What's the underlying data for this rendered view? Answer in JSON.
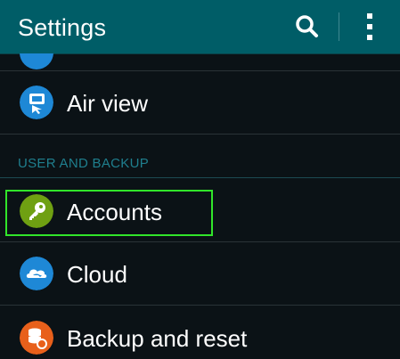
{
  "header": {
    "title": "Settings",
    "search_icon": "search-icon",
    "more_icon": "more-vertical-icon",
    "background_color": "#005d67"
  },
  "list": {
    "air_view": {
      "label": "Air view",
      "icon": "air-view-icon",
      "color": "#1e88d6"
    },
    "section_user_backup": "USER AND BACKUP",
    "accounts": {
      "label": "Accounts",
      "icon": "key-icon",
      "color": "#6fa012"
    },
    "cloud": {
      "label": "Cloud",
      "icon": "cloud-icon",
      "color": "#1e88d6"
    },
    "backup_reset": {
      "label": "Backup and reset",
      "icon": "backup-reset-icon",
      "color": "#e8601b"
    }
  },
  "highlight_color": "#31e52a"
}
